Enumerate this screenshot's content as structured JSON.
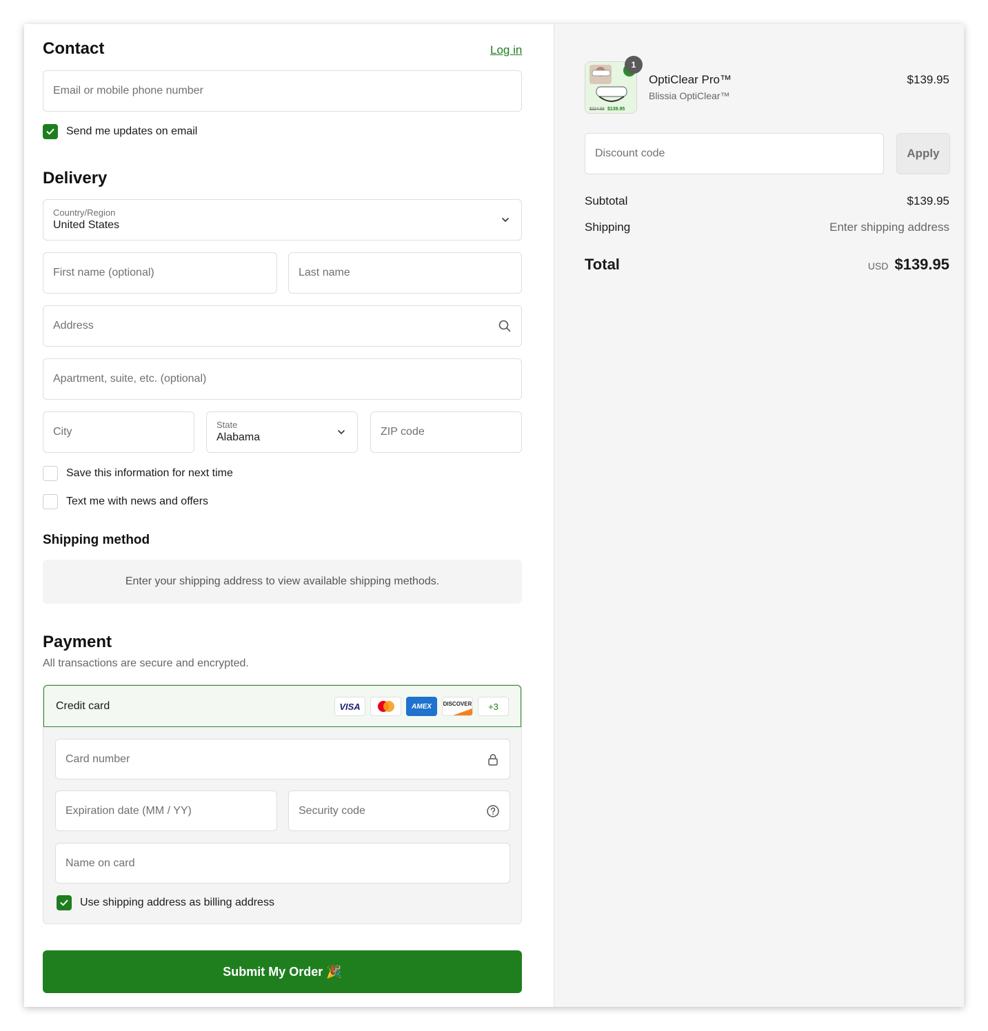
{
  "contact": {
    "title": "Contact",
    "login_label": "Log in",
    "email_placeholder": "Email or mobile phone number",
    "updates_label": "Send me updates on email",
    "updates_checked": true
  },
  "delivery": {
    "title": "Delivery",
    "country_label": "Country/Region",
    "country_value": "United States",
    "first_name_placeholder": "First name (optional)",
    "last_name_placeholder": "Last name",
    "address_placeholder": "Address",
    "apartment_placeholder": "Apartment, suite, etc. (optional)",
    "city_placeholder": "City",
    "state_label": "State",
    "state_value": "Alabama",
    "zip_placeholder": "ZIP code",
    "save_info_label": "Save this information for next time",
    "text_offers_label": "Text me with news and offers"
  },
  "shipping_method": {
    "title": "Shipping method",
    "message": "Enter your shipping address to view available shipping methods."
  },
  "payment": {
    "title": "Payment",
    "subtitle": "All transactions are secure and encrypted.",
    "method_label": "Credit card",
    "brands": [
      "VISA",
      "mastercard",
      "AMEX",
      "DISCOVER"
    ],
    "more_brands": "+3",
    "card_number_placeholder": "Card number",
    "expiration_placeholder": "Expiration date (MM / YY)",
    "security_placeholder": "Security code",
    "name_placeholder": "Name on card",
    "billing_same_label": "Use shipping address as billing address",
    "billing_same_checked": true
  },
  "submit": {
    "label": "Submit My Order 🎉"
  },
  "summary": {
    "item": {
      "name": "OptiClear Pro™",
      "variant": "Blissia OptiClear™",
      "price": "$139.95",
      "quantity": "1",
      "thumb_old_price": "$324.99",
      "thumb_new_price": "$139.95"
    },
    "discount_placeholder": "Discount code",
    "apply_label": "Apply",
    "subtotal_label": "Subtotal",
    "subtotal_value": "$139.95",
    "shipping_label": "Shipping",
    "shipping_value": "Enter shipping address",
    "total_label": "Total",
    "currency": "USD",
    "total_value": "$139.95"
  },
  "colors": {
    "accent": "#1e7e1e",
    "panel_bg": "#f5f5f5"
  }
}
